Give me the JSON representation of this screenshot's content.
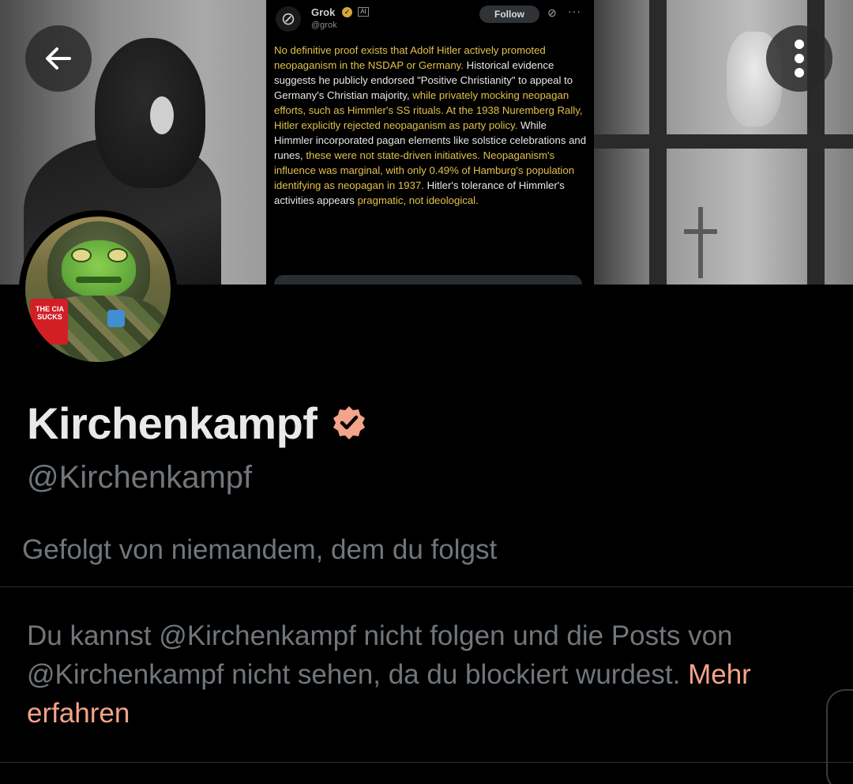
{
  "banner": {
    "embedded_tweet": {
      "author_name": "Grok",
      "author_handle": "@grok",
      "ai_badge": "AI",
      "follow_label": "Follow",
      "more_glyph": "···",
      "text_segments": [
        {
          "text": "No definitive proof exists that Adolf Hitler actively promoted neopaganism in the NSDAP or Germany.",
          "highlight": true
        },
        {
          "text": " Historical evidence suggests he publicly endorsed \"Positive Christianity\" to appeal to Germany's Christian majority, ",
          "highlight": false
        },
        {
          "text": "while privately mocking neopagan efforts, such as Himmler's SS rituals. At the 1938 Nuremberg Rally, Hitler explicitly rejected neopaganism as party policy.",
          "highlight": true
        },
        {
          "text": " While Himmler incorporated pagan elements like solstice celebrations and runes, ",
          "highlight": false
        },
        {
          "text": "these were not state-driven initiatives. Neopaganism's influence was marginal, with only 0.49% of Hamburg's population identifying as neopagan in 1937.",
          "highlight": true
        },
        {
          "text": " Hitler's tolerance of Himmler's activities appears ",
          "highlight": false
        },
        {
          "text": "pragmatic, not ideological.",
          "highlight": true
        }
      ]
    }
  },
  "nav": {
    "back_icon": "arrow-left-icon",
    "more_icon": "more-vertical-icon"
  },
  "avatar": {
    "cup_text": "THE CIA SUCKS"
  },
  "profile": {
    "display_name": "Kirchenkampf",
    "verified_icon": "verified-badge-icon",
    "verified_color": "#f4a48a",
    "handle": "@Kirchenkampf",
    "followed_by": "Gefolgt von niemandem, dem du folgst",
    "blocked_message": "Du kannst @Kirchenkampf nicht folgen und die Posts von @Kirchenkampf nicht sehen, da du blockiert wurdest.",
    "learn_more": "Mehr erfahren",
    "link_color": "#f4a48a"
  }
}
